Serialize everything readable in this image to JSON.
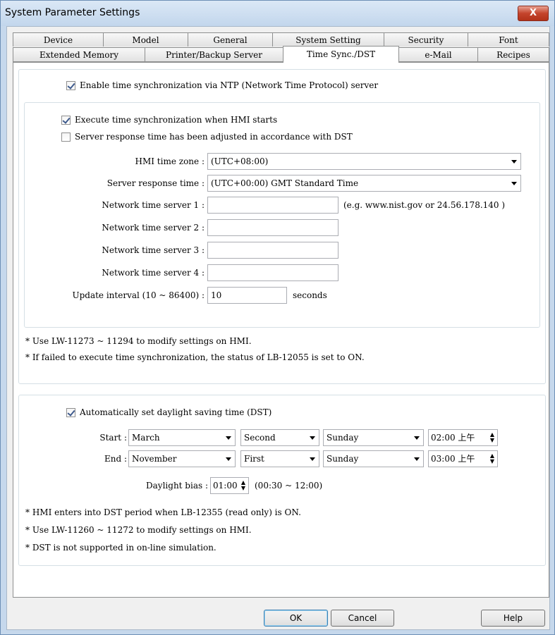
{
  "window": {
    "title": "System Parameter Settings",
    "close_label": "X"
  },
  "tabs_row1": [
    "Device",
    "Model",
    "General",
    "System Setting",
    "Security",
    "Font"
  ],
  "tabs_row2": [
    "Extended Memory",
    "Printer/Backup Server",
    "Time Sync./DST",
    "e-Mail",
    "Recipes"
  ],
  "active_tab": "Time Sync./DST",
  "ntp": {
    "enable_label": "Enable time synchronization via NTP (Network Time Protocol) server",
    "enable_checked": true,
    "exec_on_start_label": "Execute time synchronization when HMI starts",
    "exec_on_start_checked": true,
    "dst_adjust_label": "Server response time has been adjusted in accordance with DST",
    "dst_adjust_checked": false,
    "hmi_tz_label": "HMI time zone :",
    "hmi_tz_value": "(UTC+08:00)",
    "server_resp_label": "Server response time :",
    "server_resp_value": "(UTC+00:00) GMT Standard Time",
    "server1_label": "Network time server 1 :",
    "server1_value": "",
    "server1_hint": "(e.g. www.nist.gov or 24.56.178.140 )",
    "server2_label": "Network time server 2 :",
    "server2_value": "",
    "server3_label": "Network time server 3 :",
    "server3_value": "",
    "server4_label": "Network time server 4 :",
    "server4_value": "",
    "interval_label": "Update interval (10 ~ 86400) :",
    "interval_value": "10",
    "interval_unit": "seconds",
    "note1": "* Use LW-11273 ~ 11294 to modify settings on HMI.",
    "note2": "* If failed to execute time synchronization, the status of LB-12055 is set to ON."
  },
  "dst": {
    "auto_label": "Automatically set daylight saving time (DST)",
    "auto_checked": true,
    "start_label": "Start :",
    "start_month": "March",
    "start_week": "Second",
    "start_day": "Sunday",
    "start_time": "02:00 上午",
    "end_label": "End :",
    "end_month": "November",
    "end_week": "First",
    "end_day": "Sunday",
    "end_time": "03:00 上午",
    "bias_label": "Daylight bias :",
    "bias_value": "01:00",
    "bias_range": "(00:30 ~ 12:00)",
    "note1": "* HMI enters into DST period when LB-12355 (read only) is ON.",
    "note2": "* Use LW-11260 ~ 11272 to modify settings on HMI.",
    "note3": "* DST is not supported in on-line simulation."
  },
  "buttons": {
    "ok": "OK",
    "cancel": "Cancel",
    "help": "Help"
  }
}
